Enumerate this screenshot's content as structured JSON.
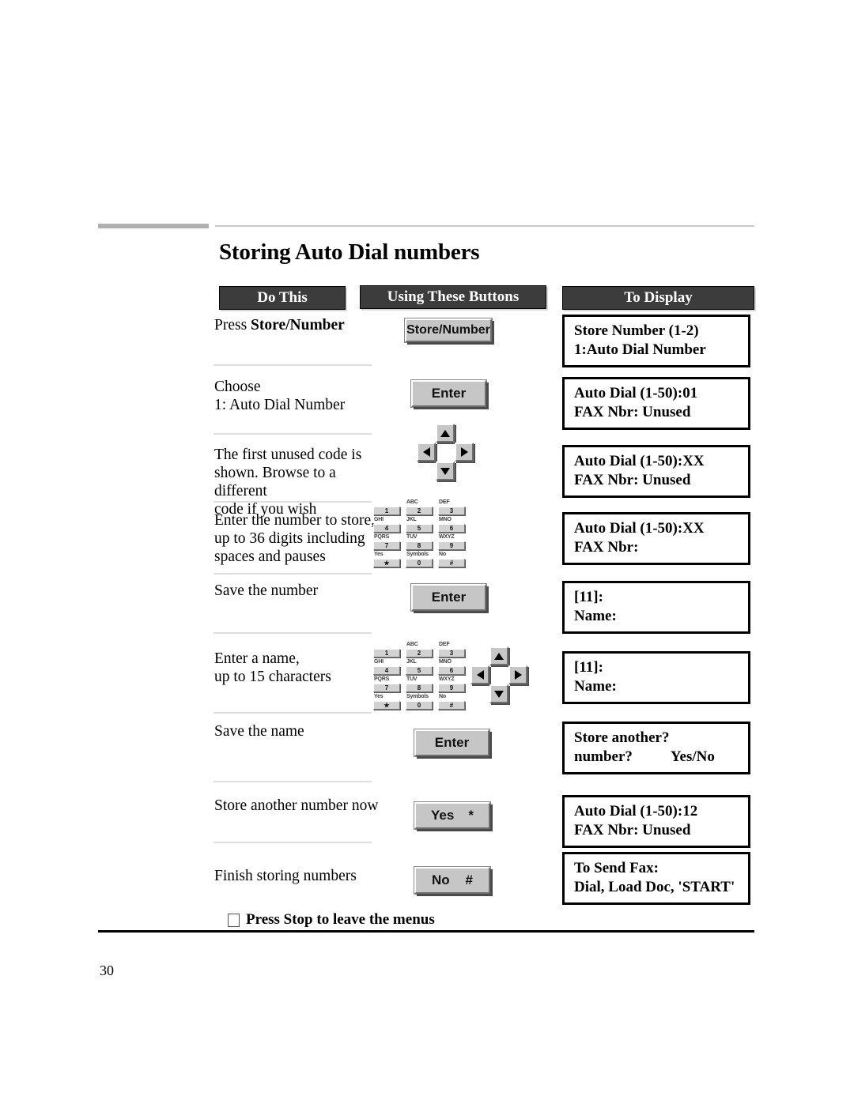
{
  "page": {
    "title": "Storing Auto Dial numbers",
    "number": "30"
  },
  "table": {
    "headers": {
      "do_this": "Do This",
      "using_these_buttons": "Using These Buttons",
      "to_display": "To Display"
    },
    "rows": [
      {
        "instruction_plain": "Press ",
        "instruction_bold": "Store/Number",
        "display_line1": "Store Number (1-2)",
        "display_line2": "1:Auto Dial Number"
      },
      {
        "instruction_line1": "Choose",
        "instruction_line2": "1: Auto Dial Number",
        "display_line1": "Auto Dial (1-50):01",
        "display_line2": "FAX Nbr: Unused"
      },
      {
        "instruction_line1": "The first unused  code is",
        "instruction_line2": "shown.  Browse to a different",
        "instruction_line3": "code if you wish",
        "display_line1": "Auto Dial (1-50):XX",
        "display_line2": "FAX Nbr: Unused"
      },
      {
        "instruction_line1": "Enter the number to store,",
        "instruction_line2": "up to 36 digits including",
        "instruction_line3": "spaces and pauses",
        "display_line1": "Auto Dial (1-50):XX",
        "display_line2": "FAX Nbr:"
      },
      {
        "instruction_line1": "Save the number",
        "display_line1": "[11]:",
        "display_line2": "Name:"
      },
      {
        "instruction_line1": "Enter a name,",
        "instruction_line2": "up to 15 characters",
        "display_line1": "[11]:",
        "display_line2": "Name:"
      },
      {
        "instruction_line1": "Save the name",
        "display_line1": "Store another?",
        "display_line2": "number?",
        "display_line2_right": "Yes/No"
      },
      {
        "instruction_line1": "Store another number now",
        "display_line1": "Auto Dial (1-50):12",
        "display_line2": "FAX Nbr: Unused"
      },
      {
        "instruction_line1": "Finish storing numbers",
        "display_line1": "To Send Fax:",
        "display_line2": "Dial, Load Doc, 'START'"
      }
    ]
  },
  "buttons": {
    "store_number": "Store/Number",
    "enter": "Enter",
    "yes_label": "Yes",
    "yes_symbol": "*",
    "no_label": "No",
    "no_symbol": "#"
  },
  "keypad": {
    "keys": [
      {
        "letters": "",
        "digit": "1"
      },
      {
        "letters": "ABC",
        "digit": "2"
      },
      {
        "letters": "DEF",
        "digit": "3"
      },
      {
        "letters": "GHI",
        "digit": "4"
      },
      {
        "letters": "JKL",
        "digit": "5"
      },
      {
        "letters": "MNO",
        "digit": "6"
      },
      {
        "letters": "PQRS",
        "digit": "7"
      },
      {
        "letters": "TUV",
        "digit": "8"
      },
      {
        "letters": "WXYZ",
        "digit": "9"
      },
      {
        "letters": "Yes",
        "digit": "★"
      },
      {
        "letters": "Symbols",
        "digit": "0"
      },
      {
        "letters": "No",
        "digit": "#"
      }
    ]
  },
  "footer": {
    "note": "Press Stop to leave the menus"
  },
  "colors": {
    "header_bar": "#3c3c3c",
    "header_text": "#ffffff",
    "button_face": "#c6c6c6",
    "rule": "#b0b0b0",
    "separator": "#dedede"
  }
}
